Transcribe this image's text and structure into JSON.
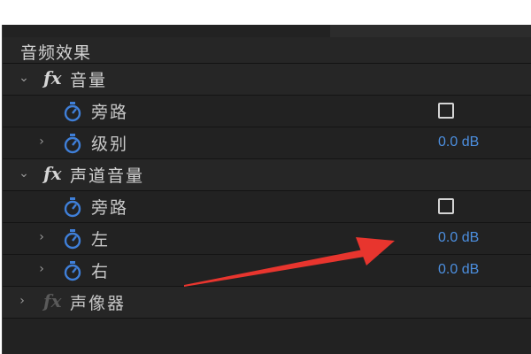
{
  "panel": {
    "title": "音频效果"
  },
  "groups": [
    {
      "label": "音量",
      "fx": "fx",
      "properties": [
        {
          "label": "旁路",
          "kind": "checkbox",
          "checked": false
        },
        {
          "label": "级别",
          "kind": "value",
          "value": "0.0 dB"
        }
      ]
    },
    {
      "label": "声道音量",
      "fx": "fx",
      "properties": [
        {
          "label": "旁路",
          "kind": "checkbox",
          "checked": false
        },
        {
          "label": "左",
          "kind": "value",
          "value": "0.0 dB"
        },
        {
          "label": "右",
          "kind": "value",
          "value": "0.0 dB"
        }
      ]
    },
    {
      "label": "声像器",
      "fx": "fx",
      "collapsed": true,
      "disabled": true
    }
  ],
  "icons": {
    "expand": "chevron-down-icon",
    "collapse": "chevron-right-icon",
    "fx": "fx-icon",
    "stopwatch": "stopwatch-icon"
  },
  "colors": {
    "panel_bg": "#222222",
    "value_blue": "#4c8fe0",
    "stopwatch_blue": "#3f7fd8",
    "annotation_arrow": "#e8352e"
  }
}
